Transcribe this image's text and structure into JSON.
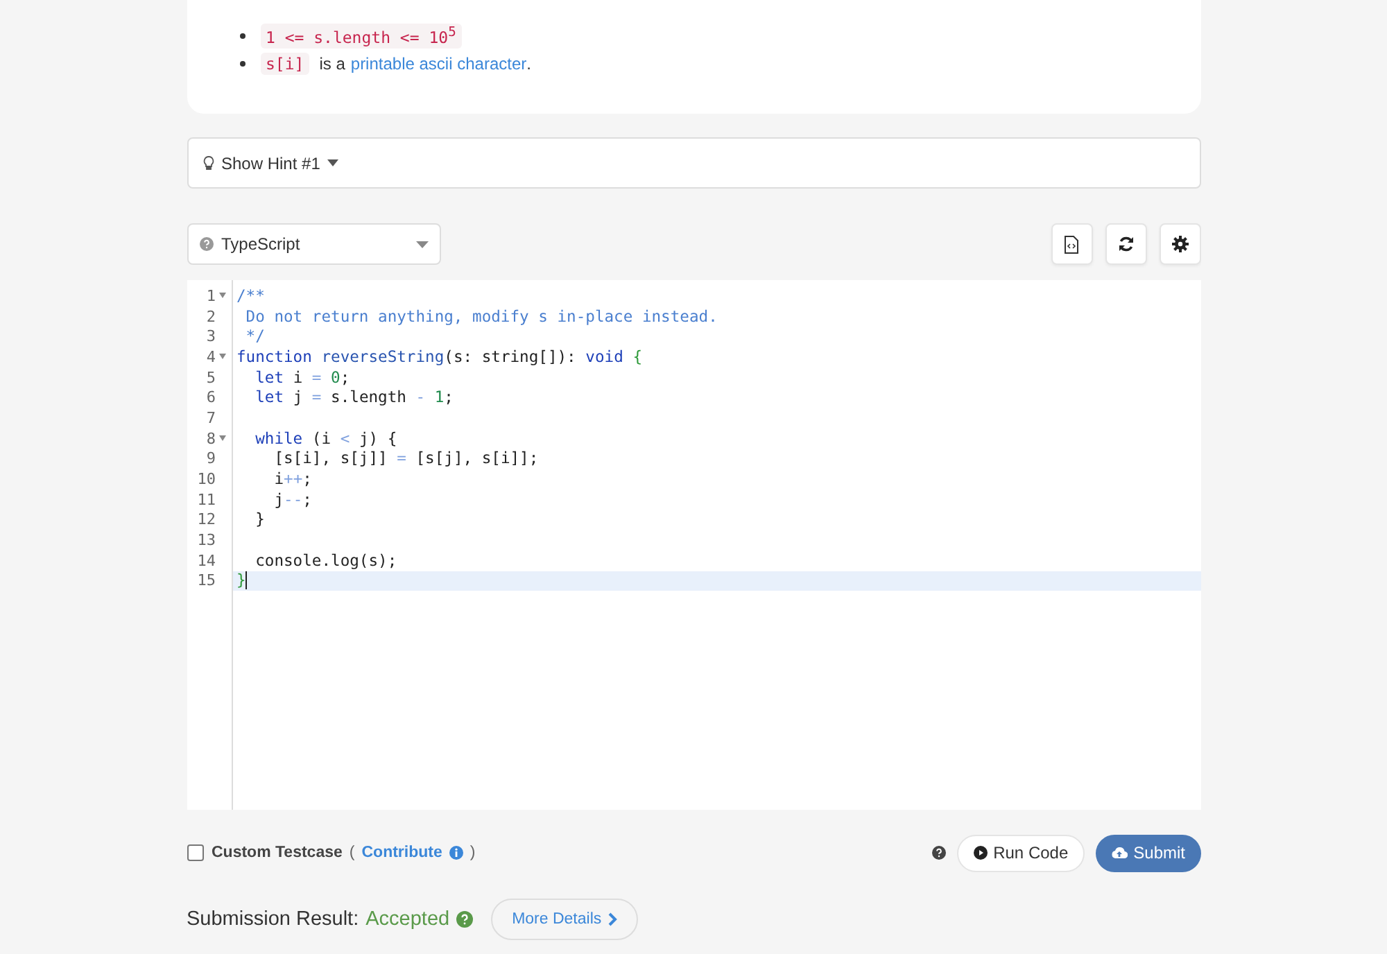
{
  "constraints": [
    {
      "kind": "code",
      "code": "1 <= s.length <= 10$^{5}$"
    },
    {
      "kind": "mixed",
      "code": "s[i]",
      "text": "is a",
      "link": "printable ascii character",
      "end": "."
    }
  ],
  "hint": {
    "label": "Show Hint #1",
    "expanded": false
  },
  "language": {
    "value": "TypeScript"
  },
  "editor": {
    "lines": [
      {
        "number": "1",
        "foldable": true,
        "active": false,
        "segments": [
          {
            "kind": "comment",
            "text": "/**"
          }
        ]
      },
      {
        "number": "2",
        "foldable": false,
        "active": false,
        "segments": [
          {
            "kind": "comment",
            "text": " Do not return anything, modify s in-place instead."
          }
        ]
      },
      {
        "number": "3",
        "foldable": false,
        "active": false,
        "segments": [
          {
            "kind": "comment",
            "text": " */"
          }
        ]
      },
      {
        "number": "4",
        "foldable": true,
        "active": false,
        "segments": [
          {
            "kind": "keyword",
            "text": "function "
          },
          {
            "kind": "func",
            "text": "reverseString"
          },
          {
            "kind": "plain",
            "text": "(s: string[]): "
          },
          {
            "kind": "keyword",
            "text": "void "
          },
          {
            "kind": "brace",
            "text": "{"
          }
        ]
      },
      {
        "number": "5",
        "foldable": false,
        "active": false,
        "segments": [
          {
            "kind": "keyword",
            "text": "  let"
          },
          {
            "kind": "plain",
            "text": " i "
          },
          {
            "kind": "op",
            "text": "="
          },
          {
            "kind": "number",
            "text": " 0"
          },
          {
            "kind": "plain",
            "text": ";"
          }
        ]
      },
      {
        "number": "6",
        "foldable": false,
        "active": false,
        "segments": [
          {
            "kind": "keyword",
            "text": "  let"
          },
          {
            "kind": "plain",
            "text": " j "
          },
          {
            "kind": "op",
            "text": "="
          },
          {
            "kind": "plain",
            "text": " s.length "
          },
          {
            "kind": "op",
            "text": "-"
          },
          {
            "kind": "number",
            "text": " 1"
          },
          {
            "kind": "plain",
            "text": ";"
          }
        ]
      },
      {
        "number": "7",
        "foldable": false,
        "active": false
      },
      {
        "number": "8",
        "foldable": true,
        "active": false,
        "segments": [
          {
            "kind": "keyword",
            "text": "  while"
          },
          {
            "kind": "plain",
            "text": " (i "
          },
          {
            "kind": "op",
            "text": "<"
          },
          {
            "kind": "plain",
            "text": " j) {"
          }
        ]
      },
      {
        "number": "9",
        "foldable": false,
        "active": false,
        "segments": [
          {
            "kind": "plain",
            "text": "    [s[i], s[j]] "
          },
          {
            "kind": "op",
            "text": "="
          },
          {
            "kind": "plain",
            "text": " [s[j], s[i]];"
          }
        ]
      },
      {
        "number": "10",
        "foldable": false,
        "active": false,
        "segments": [
          {
            "kind": "plain",
            "text": "    i"
          },
          {
            "kind": "op",
            "text": "++"
          },
          {
            "kind": "plain",
            "text": ";"
          }
        ]
      },
      {
        "number": "11",
        "foldable": false,
        "active": false,
        "segments": [
          {
            "kind": "plain",
            "text": "    j"
          },
          {
            "kind": "op",
            "text": "--"
          },
          {
            "kind": "plain",
            "text": ";"
          }
        ]
      },
      {
        "number": "12",
        "foldable": false,
        "active": false,
        "segments": [
          {
            "kind": "plain",
            "text": "  }"
          }
        ]
      },
      {
        "number": "13",
        "foldable": false,
        "active": false
      },
      {
        "number": "14",
        "foldable": false,
        "active": false,
        "segments": [
          {
            "kind": "plain",
            "text": "  console.log(s);"
          }
        ]
      },
      {
        "number": "15",
        "foldable": false,
        "active": true,
        "segments": [
          {
            "kind": "brace",
            "text": "}"
          }
        ]
      }
    ]
  },
  "custom_testcase": {
    "label": "Custom Testcase",
    "checked": false,
    "open": "(",
    "link": "Contribute",
    "close": ")"
  },
  "buttons": {
    "run": "Run Code",
    "submit": "Submit"
  },
  "result": {
    "label": "Submission Result:",
    "status": "Accepted",
    "details": "More Details"
  }
}
